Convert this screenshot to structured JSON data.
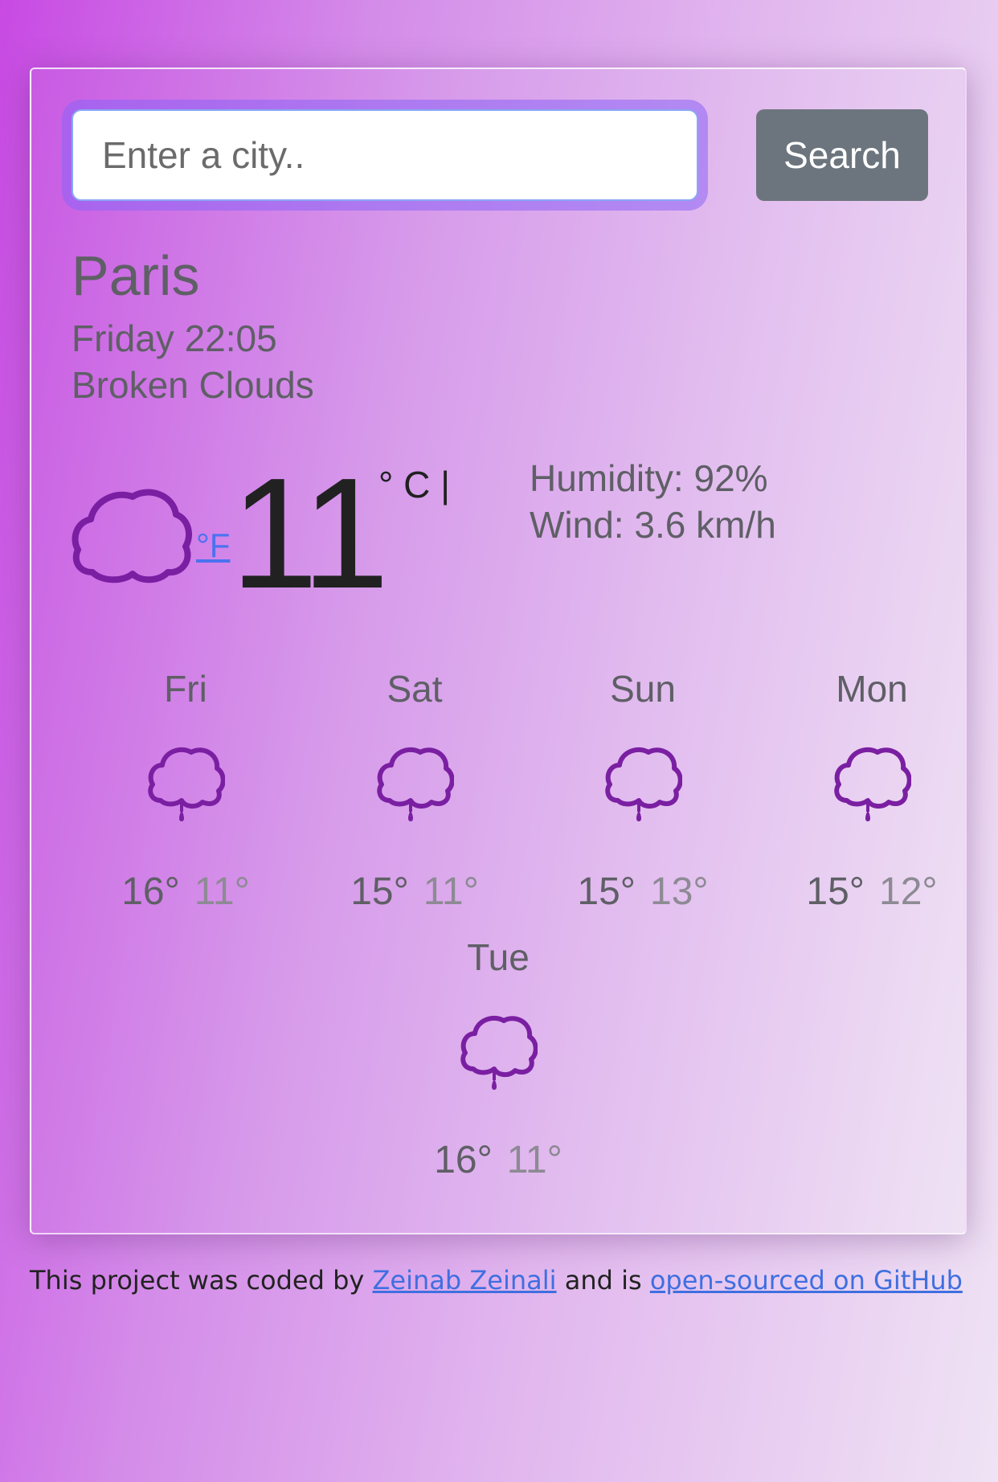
{
  "search": {
    "placeholder": "Enter a city..",
    "value": "",
    "button_label": "Search"
  },
  "current": {
    "city": "Paris",
    "datetime": "Friday 22:05",
    "condition": "Broken Clouds",
    "icon": "cloud-icon",
    "temperature": "11",
    "unit_celsius": "° C |",
    "unit_fahrenheit": "°F",
    "humidity": "Humidity: 92%",
    "wind": "Wind: 3.6 km/h"
  },
  "forecast": [
    {
      "day": "Fri",
      "icon": "rain-cloud-icon",
      "max": "16°",
      "min": "11°"
    },
    {
      "day": "Sat",
      "icon": "rain-cloud-icon",
      "max": "15°",
      "min": "11°"
    },
    {
      "day": "Sun",
      "icon": "rain-cloud-icon",
      "max": "15°",
      "min": "13°"
    },
    {
      "day": "Mon",
      "icon": "rain-cloud-icon",
      "max": "15°",
      "min": "12°"
    },
    {
      "day": "Tue",
      "icon": "rain-cloud-icon",
      "max": "16°",
      "min": "11°"
    }
  ],
  "footer": {
    "text_before": "This project was coded by",
    "author_link": "Zeinab Zeinali",
    "text_middle": "and is",
    "github_link": "open-sourced on GitHub"
  },
  "colors": {
    "icon_purple": "#7a1fa2",
    "link_blue": "#3f6fe0",
    "button_gray": "#6c757d"
  }
}
